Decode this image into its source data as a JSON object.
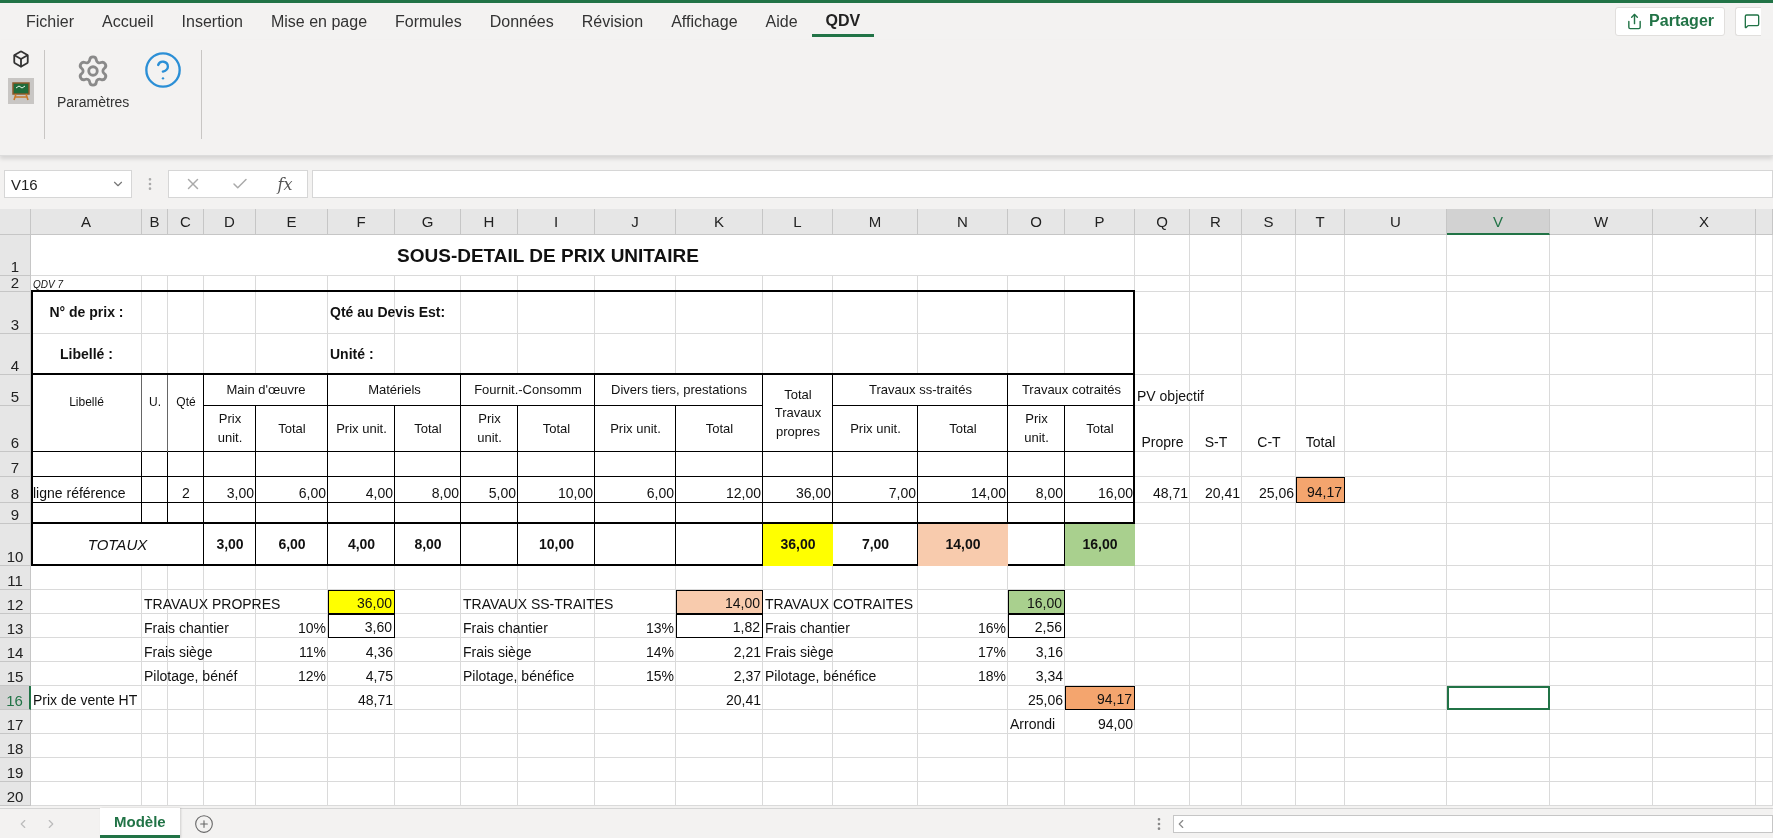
{
  "menu_tabs": [
    {
      "label": "Fichier",
      "selected": false
    },
    {
      "label": "Accueil",
      "selected": false
    },
    {
      "label": "Insertion",
      "selected": false
    },
    {
      "label": "Mise en page",
      "selected": false
    },
    {
      "label": "Formules",
      "selected": false
    },
    {
      "label": "Données",
      "selected": false
    },
    {
      "label": "Révision",
      "selected": false
    },
    {
      "label": "Affichage",
      "selected": false
    },
    {
      "label": "Aide",
      "selected": false
    },
    {
      "label": "QDV",
      "selected": true
    }
  ],
  "share_button": "Partager",
  "ribbon": {
    "settings_label": "Paramètres"
  },
  "formula_bar": {
    "name_box": "V16",
    "function_label": "fx"
  },
  "sheet": {
    "columns": [
      {
        "label": "A",
        "selected": false
      },
      {
        "label": "B",
        "selected": false
      },
      {
        "label": "C",
        "selected": false
      },
      {
        "label": "D",
        "selected": false
      },
      {
        "label": "E",
        "selected": false
      },
      {
        "label": "F",
        "selected": false
      },
      {
        "label": "G",
        "selected": false
      },
      {
        "label": "H",
        "selected": false
      },
      {
        "label": "I",
        "selected": false
      },
      {
        "label": "J",
        "selected": false
      },
      {
        "label": "K",
        "selected": false
      },
      {
        "label": "L",
        "selected": false
      },
      {
        "label": "M",
        "selected": false
      },
      {
        "label": "N",
        "selected": false
      },
      {
        "label": "O",
        "selected": false
      },
      {
        "label": "P",
        "selected": false
      },
      {
        "label": "Q",
        "selected": false
      },
      {
        "label": "R",
        "selected": false
      },
      {
        "label": "S",
        "selected": false
      },
      {
        "label": "T",
        "selected": false
      },
      {
        "label": "U",
        "selected": false
      },
      {
        "label": "V",
        "selected": true
      },
      {
        "label": "W",
        "selected": false
      },
      {
        "label": "X",
        "selected": false
      }
    ],
    "rows": [
      {
        "number": "1",
        "selected": false,
        "cells": [
          null,
          null,
          null,
          null,
          null,
          null,
          null,
          {
            "text": "SOUS-DETAIL DE PRIX UNITAIRE",
            "kind": "title"
          }
        ]
      },
      {
        "number": "2",
        "selected": false,
        "cells": [
          {
            "text": "QDV 7",
            "kind": "note"
          }
        ]
      },
      {
        "number": "3",
        "selected": false,
        "cells": [
          {
            "text": "N° de prix :",
            "kind": "bold_center"
          },
          null,
          null,
          null,
          null,
          {
            "text": "Qté au Devis Est:",
            "kind": "bold"
          }
        ]
      },
      {
        "number": "4",
        "selected": false,
        "cells": [
          {
            "text": "Libellé :",
            "kind": "bold_center"
          },
          null,
          null,
          null,
          null,
          {
            "text": "Unité :",
            "kind": "bold"
          }
        ]
      },
      {
        "number": "5",
        "selected": false,
        "cells": [
          {
            "text": "Libellé",
            "kind": "small_heading"
          },
          {
            "text": "U.",
            "kind": "small_heading"
          },
          {
            "text": "Qté",
            "kind": "small_heading"
          },
          {
            "text": "Main d'œuvre",
            "kind": "heading"
          },
          null,
          {
            "text": "Matériels",
            "kind": "heading"
          },
          null,
          {
            "text": "Fournit.-Consomm",
            "kind": "heading"
          },
          null,
          {
            "text": "Divers tiers, prestations",
            "kind": "heading"
          },
          null,
          {
            "text": "Total Travaux propres",
            "kind": "heading"
          },
          {
            "text": "Travaux ss-traités",
            "kind": "heading"
          },
          null,
          {
            "text": "Travaux cotraités",
            "kind": "heading"
          },
          null,
          {
            "text": "PV objectif",
            "kind": "text"
          }
        ]
      },
      {
        "number": "6",
        "selected": false,
        "cells": [
          null,
          null,
          null,
          {
            "text": "Prix unit.",
            "kind": "heading"
          },
          {
            "text": "Total",
            "kind": "heading"
          },
          {
            "text": "Prix unit.",
            "kind": "heading"
          },
          {
            "text": "Total",
            "kind": "heading"
          },
          {
            "text": "Prix unit.",
            "kind": "heading"
          },
          {
            "text": "Total",
            "kind": "heading"
          },
          {
            "text": "Prix unit.",
            "kind": "heading"
          },
          {
            "text": "Total",
            "kind": "heading"
          },
          null,
          {
            "text": "Prix unit.",
            "kind": "heading"
          },
          {
            "text": "Total",
            "kind": "heading"
          },
          {
            "text": "Prix unit.",
            "kind": "heading"
          },
          {
            "text": "Total",
            "kind": "heading"
          },
          {
            "text": "Propre",
            "kind": "center"
          },
          {
            "text": "S-T",
            "kind": "center"
          },
          {
            "text": "C-T",
            "kind": "center"
          },
          {
            "text": "Total",
            "kind": "center"
          }
        ]
      },
      {
        "number": "7",
        "selected": false,
        "cells": []
      },
      {
        "number": "8",
        "selected": false,
        "cells": [
          {
            "text": "ligne référence",
            "kind": "text"
          },
          null,
          {
            "text": "2",
            "kind": "center"
          },
          {
            "text": "3,00",
            "kind": "number"
          },
          {
            "text": "6,00",
            "kind": "number"
          },
          {
            "text": "4,00",
            "kind": "number"
          },
          {
            "text": "8,00",
            "kind": "number"
          },
          {
            "text": "5,00",
            "kind": "number"
          },
          {
            "text": "10,00",
            "kind": "number"
          },
          {
            "text": "6,00",
            "kind": "number"
          },
          {
            "text": "12,00",
            "kind": "number"
          },
          {
            "text": "36,00",
            "kind": "number"
          },
          {
            "text": "7,00",
            "kind": "number"
          },
          {
            "text": "14,00",
            "kind": "number"
          },
          {
            "text": "8,00",
            "kind": "number"
          },
          {
            "text": "16,00",
            "kind": "number"
          },
          {
            "text": "48,71",
            "kind": "number"
          },
          {
            "text": "20,41",
            "kind": "number"
          },
          {
            "text": "25,06",
            "kind": "number"
          },
          {
            "text": "94,17",
            "kind": "number",
            "color": "#f4a56e",
            "boxed": true
          }
        ]
      },
      {
        "number": "9",
        "selected": false,
        "cells": []
      },
      {
        "number": "10",
        "selected": false,
        "cells": [
          {
            "text": "TOTAUX",
            "kind": "italic_center"
          },
          null,
          null,
          {
            "text": "3,00",
            "kind": "total"
          },
          {
            "text": "6,00",
            "kind": "total"
          },
          {
            "text": "4,00",
            "kind": "total"
          },
          {
            "text": "8,00",
            "kind": "total"
          },
          null,
          {
            "text": "10,00",
            "kind": "total"
          },
          null,
          null,
          {
            "text": "36,00",
            "kind": "total",
            "color": "#ffff00"
          },
          {
            "text": "7,00",
            "kind": "total"
          },
          {
            "text": "14,00",
            "kind": "total",
            "color": "#f8cbad"
          },
          null,
          {
            "text": "16,00",
            "kind": "total",
            "color": "#a9d08e"
          }
        ]
      },
      {
        "number": "11",
        "selected": false,
        "cells": []
      },
      {
        "number": "12",
        "selected": false,
        "cells": [
          null,
          {
            "text": "TRAVAUX PROPRES",
            "kind": "text"
          },
          null,
          null,
          null,
          {
            "text": "36,00",
            "kind": "number",
            "color": "#ffff00",
            "boxed": true
          },
          null,
          {
            "text": "TRAVAUX SS-TRAITES",
            "kind": "text"
          },
          null,
          null,
          {
            "text": "14,00",
            "kind": "number",
            "color": "#f8cbad",
            "boxed": true
          },
          {
            "text": "TRAVAUX COTRAITES",
            "kind": "text"
          },
          null,
          null,
          {
            "text": "16,00",
            "kind": "number",
            "color": "#a9d08e",
            "boxed": true
          }
        ]
      },
      {
        "number": "13",
        "selected": false,
        "cells": [
          null,
          {
            "text": "Frais chantier",
            "kind": "text"
          },
          null,
          null,
          {
            "text": "10%",
            "kind": "number"
          },
          {
            "text": "3,60",
            "kind": "number",
            "boxed": true
          },
          null,
          {
            "text": "Frais chantier",
            "kind": "text"
          },
          null,
          {
            "text": "13%",
            "kind": "number"
          },
          {
            "text": "1,82",
            "kind": "number",
            "boxed": true
          },
          {
            "text": "Frais chantier",
            "kind": "text"
          },
          null,
          {
            "text": "16%",
            "kind": "number"
          },
          {
            "text": "2,56",
            "kind": "number",
            "boxed": true
          }
        ]
      },
      {
        "number": "14",
        "selected": false,
        "cells": [
          null,
          {
            "text": "Frais siège",
            "kind": "text"
          },
          null,
          null,
          {
            "text": "11%",
            "kind": "number"
          },
          {
            "text": "4,36",
            "kind": "number"
          },
          null,
          {
            "text": "Frais siège",
            "kind": "text"
          },
          null,
          {
            "text": "14%",
            "kind": "number"
          },
          {
            "text": "2,21",
            "kind": "number"
          },
          {
            "text": "Frais siège",
            "kind": "text"
          },
          null,
          {
            "text": "17%",
            "kind": "number"
          },
          {
            "text": "3,16",
            "kind": "number"
          }
        ]
      },
      {
        "number": "15",
        "selected": false,
        "cells": [
          null,
          {
            "text": "Pilotage, bénéf",
            "kind": "text"
          },
          null,
          null,
          {
            "text": "12%",
            "kind": "number"
          },
          {
            "text": "4,75",
            "kind": "number"
          },
          null,
          {
            "text": "Pilotage, bénéfice",
            "kind": "text"
          },
          null,
          {
            "text": "15%",
            "kind": "number"
          },
          {
            "text": "2,37",
            "kind": "number"
          },
          {
            "text": "Pilotage, bénéfice",
            "kind": "text"
          },
          null,
          {
            "text": "18%",
            "kind": "number"
          },
          {
            "text": "3,34",
            "kind": "number"
          }
        ]
      },
      {
        "number": "16",
        "selected": true,
        "cells": [
          {
            "text": "Prix de vente HT",
            "kind": "text"
          },
          null,
          null,
          null,
          null,
          {
            "text": "48,71",
            "kind": "number"
          },
          null,
          null,
          null,
          null,
          {
            "text": "20,41",
            "kind": "number"
          },
          null,
          null,
          null,
          {
            "text": "25,06",
            "kind": "number"
          },
          {
            "text": "94,17",
            "kind": "number",
            "color": "#f4a56e",
            "boxed": true
          }
        ]
      },
      {
        "number": "17",
        "selected": false,
        "cells": [
          null,
          null,
          null,
          null,
          null,
          null,
          null,
          null,
          null,
          null,
          null,
          null,
          null,
          null,
          {
            "text": "Arrondi",
            "kind": "text"
          },
          {
            "text": "94,00",
            "kind": "number"
          }
        ]
      },
      {
        "number": "18",
        "selected": false,
        "cells": []
      },
      {
        "number": "19",
        "selected": false,
        "cells": []
      },
      {
        "number": "20",
        "selected": false,
        "cells": []
      }
    ]
  },
  "sheet_tabs": [
    {
      "label": "Modèle",
      "selected": true
    }
  ]
}
